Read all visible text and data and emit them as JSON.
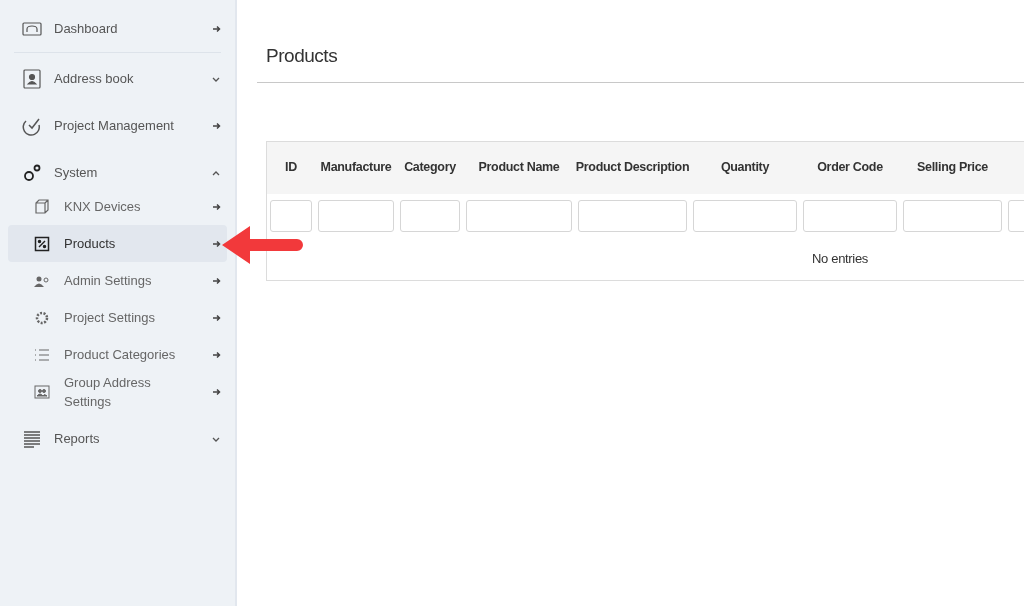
{
  "sidebar": {
    "items": [
      {
        "label": "Dashboard",
        "kind": "link"
      },
      {
        "label": "Address book",
        "kind": "group",
        "expanded": false
      },
      {
        "label": "Project Management",
        "kind": "link"
      },
      {
        "label": "System",
        "kind": "group",
        "expanded": true,
        "children": [
          {
            "label": "KNX Devices",
            "selected": false
          },
          {
            "label": "Products",
            "selected": true
          },
          {
            "label": "Admin Settings",
            "selected": false
          },
          {
            "label": "Project Settings",
            "selected": false
          },
          {
            "label": "Product Categories",
            "selected": false
          },
          {
            "label": "Group Address Settings",
            "selected": false
          }
        ]
      },
      {
        "label": "Reports",
        "kind": "group",
        "expanded": false
      }
    ]
  },
  "page": {
    "title": "Products"
  },
  "table": {
    "columns": [
      "ID",
      "Manufacture",
      "Category",
      "Product Name",
      "Product Description",
      "Quantity",
      "Order Code",
      "Selling Price"
    ],
    "empty_message": "No entries"
  }
}
